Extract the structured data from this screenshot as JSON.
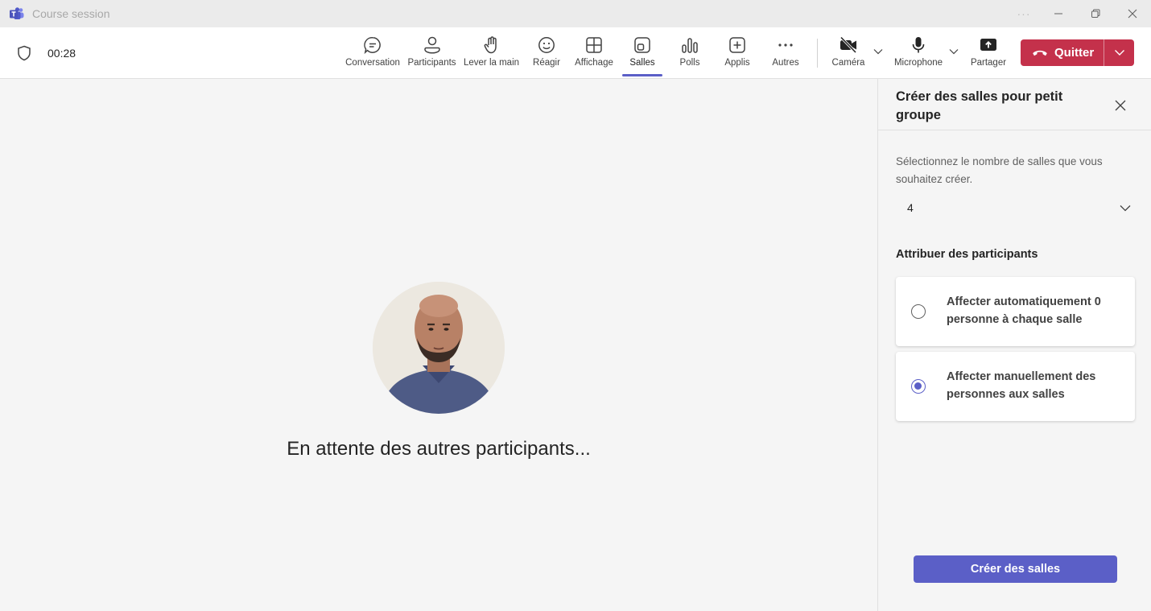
{
  "window": {
    "title": "Course session",
    "controls": {
      "more": "···",
      "minimize": "minimize-icon",
      "restore": "restore-icon",
      "close": "close-icon"
    }
  },
  "meeting": {
    "timer": "00:28",
    "tools": [
      {
        "id": "chat",
        "label": "Conversation",
        "icon": "chat-icon"
      },
      {
        "id": "people",
        "label": "Participants",
        "icon": "people-icon"
      },
      {
        "id": "hand",
        "label": "Lever la main",
        "icon": "raise-hand-icon"
      },
      {
        "id": "react",
        "label": "Réagir",
        "icon": "emoji-icon"
      },
      {
        "id": "view",
        "label": "Affichage",
        "icon": "grid-view-icon"
      },
      {
        "id": "rooms",
        "label": "Salles",
        "icon": "breakout-rooms-icon",
        "active": true
      },
      {
        "id": "polls",
        "label": "Polls",
        "icon": "polls-icon"
      },
      {
        "id": "apps",
        "label": "Applis",
        "icon": "add-apps-icon"
      },
      {
        "id": "more",
        "label": "Autres",
        "icon": "more-icon"
      }
    ],
    "camera_label": "Caméra",
    "mic_label": "Microphone",
    "share_label": "Partager",
    "leave_label": "Quitter",
    "colors": {
      "accent": "#5b5fc7",
      "leave": "#c4314b"
    }
  },
  "stage": {
    "waiting_text": "En attente des autres participants..."
  },
  "panel": {
    "title": "Créer des salles pour petit groupe",
    "instruction": "Sélectionnez le nombre de salles que vous souhaitez créer.",
    "room_count": "4",
    "assign_label": "Attribuer des participants",
    "options": [
      {
        "label": "Affecter automatiquement 0 personne à chaque salle",
        "selected": false
      },
      {
        "label": "Affecter manuellement des personnes aux salles",
        "selected": true
      }
    ],
    "create_button": "Créer des salles"
  }
}
